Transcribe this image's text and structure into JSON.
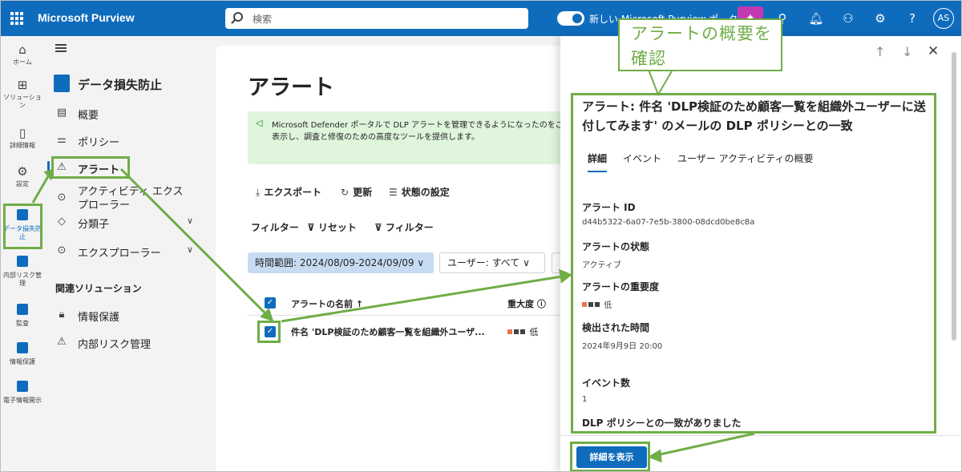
{
  "topbar": {
    "brand": "Microsoft Purview",
    "search_placeholder": "検索",
    "toggle_label": "新しい Microsoft Purview ポータル",
    "avatar": "AS"
  },
  "rail": {
    "items": [
      {
        "label": "ホーム",
        "icon": "home-icon"
      },
      {
        "label": "ソリューション",
        "icon": "apps-icon"
      },
      {
        "label": "詳細情報",
        "icon": "book-icon"
      },
      {
        "label": "設定",
        "icon": "gear-icon"
      },
      {
        "label": "データ損失防止",
        "icon": "dlp-icon"
      },
      {
        "label": "内部リスク管理",
        "icon": "insider-risk-icon"
      },
      {
        "label": "監査",
        "icon": "audit-icon"
      },
      {
        "label": "情報保護",
        "icon": "info-protection-icon"
      },
      {
        "label": "電子情報開示",
        "icon": "ediscovery-icon"
      }
    ]
  },
  "nav": {
    "title": "データ損失防止",
    "items": [
      {
        "label": "概要",
        "icon": "overview-icon"
      },
      {
        "label": "ポリシー",
        "icon": "policy-icon"
      },
      {
        "label": "アラート",
        "icon": "alert-icon"
      },
      {
        "label": "アクティビティ エクスプローラー",
        "icon": "activity-explorer-icon"
      },
      {
        "label": "分類子",
        "icon": "classifier-icon"
      },
      {
        "label": "エクスプローラー",
        "icon": "explorer-icon"
      }
    ],
    "related_heading": "関連ソリューション",
    "related": [
      {
        "label": "情報保護",
        "icon": "info-protection-icon"
      },
      {
        "label": "内部リスク管理",
        "icon": "insider-risk-icon"
      }
    ]
  },
  "main": {
    "title": "アラート",
    "banner_line1": "Microsoft Defender ポータルで DLP アラートを管理できるようになったのをご存",
    "banner_line2": "表示し、調査と修復のための高度なツールを提供します。",
    "commands": {
      "export": "エクスポート",
      "refresh": "更新",
      "set_state": "状態の設定"
    },
    "filters": {
      "label": "フィルター",
      "reset": "リセット",
      "filter": "フィルター"
    },
    "time_range": "時間範囲: 2024/08/09-2024/09/09",
    "user_filter": "ユーザー: すべて",
    "columns": {
      "name": "アラートの名前 ↑",
      "severity": "重大度"
    },
    "rows": [
      {
        "name": "件名 'DLP検証のため顧客一覧を組織外ユーザ...",
        "severity": "低"
      }
    ]
  },
  "flyout": {
    "title": "アラート: 件名 'DLP検証のため顧客一覧を組織外ユーザーに送付してみます' のメールの DLP ポリシーとの一致",
    "tabs": [
      "詳細",
      "イベント",
      "ユーザー アクティビティの概要"
    ],
    "fields": [
      {
        "label": "アラート ID",
        "value": "d44b5322-6a07-7e5b-3800-08dcd0be8c8a"
      },
      {
        "label": "アラートの状態",
        "value": "アクティブ"
      },
      {
        "label": "アラートの重要度",
        "value": "低"
      },
      {
        "label": "検出された時間",
        "value": "2024年9月9日 20:00"
      },
      {
        "label": "イベント数",
        "value": "1"
      },
      {
        "label": "DLP ポリシーとの一致がありました",
        "value": ""
      }
    ],
    "button": "詳細を表示"
  },
  "annotation": {
    "callout": "アラートの概要を確認"
  },
  "colors": {
    "brand": "#0f6cbd",
    "annotation": "#70ad47",
    "severity_low": "#e97548",
    "severity_dark": "#424242"
  }
}
